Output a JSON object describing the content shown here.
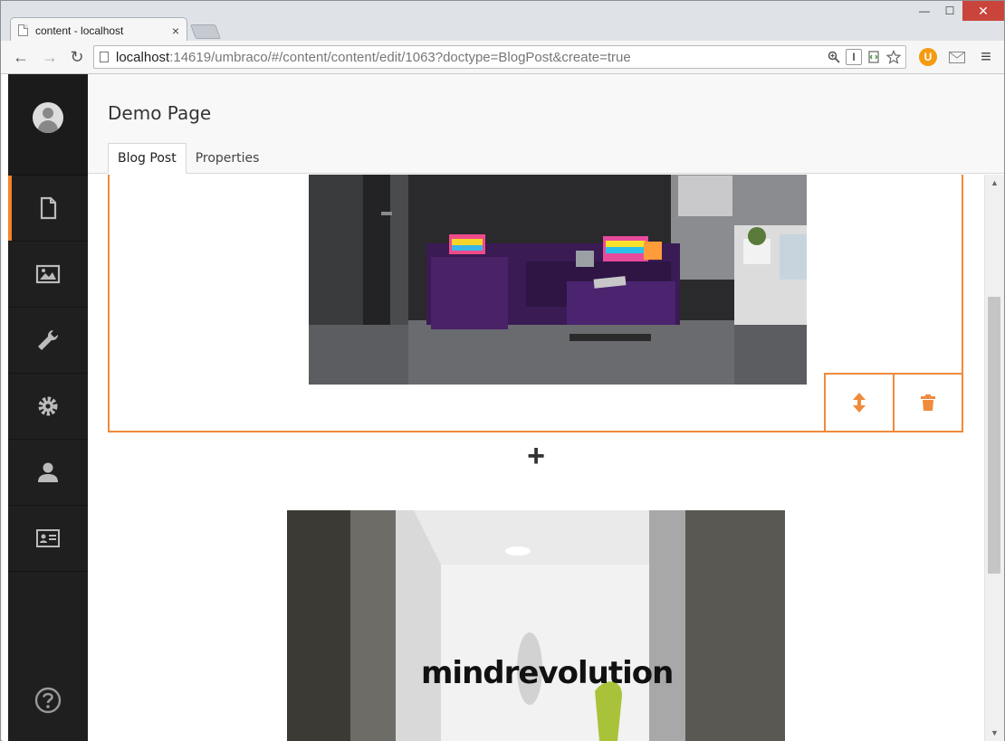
{
  "browser": {
    "tab_title": "content - localhost",
    "tab_close": "×",
    "url_host": "localhost",
    "url_rest": ":14619/umbraco/#/content/content/edit/1063?doctype=BlogPost&create=true",
    "back": "←",
    "forward": "→",
    "reload": "↻",
    "minimize": "—",
    "maximize": "☐",
    "close": "✕",
    "reader_mode": "I",
    "menu": "≡",
    "ext_umbraco": "U"
  },
  "sidebar": {
    "items": [
      "content-icon",
      "media-icon",
      "settings-wrench-icon",
      "developer-gear-icon",
      "users-icon",
      "members-icon"
    ],
    "help": "help-icon"
  },
  "header": {
    "title": "Demo Page",
    "tabs": [
      {
        "label": "Blog Post",
        "active": true
      },
      {
        "label": "Properties",
        "active": false
      }
    ]
  },
  "editor": {
    "add_symbol": "+",
    "image2_text": "mindrevolution",
    "accent_color": "#f08a3c"
  }
}
